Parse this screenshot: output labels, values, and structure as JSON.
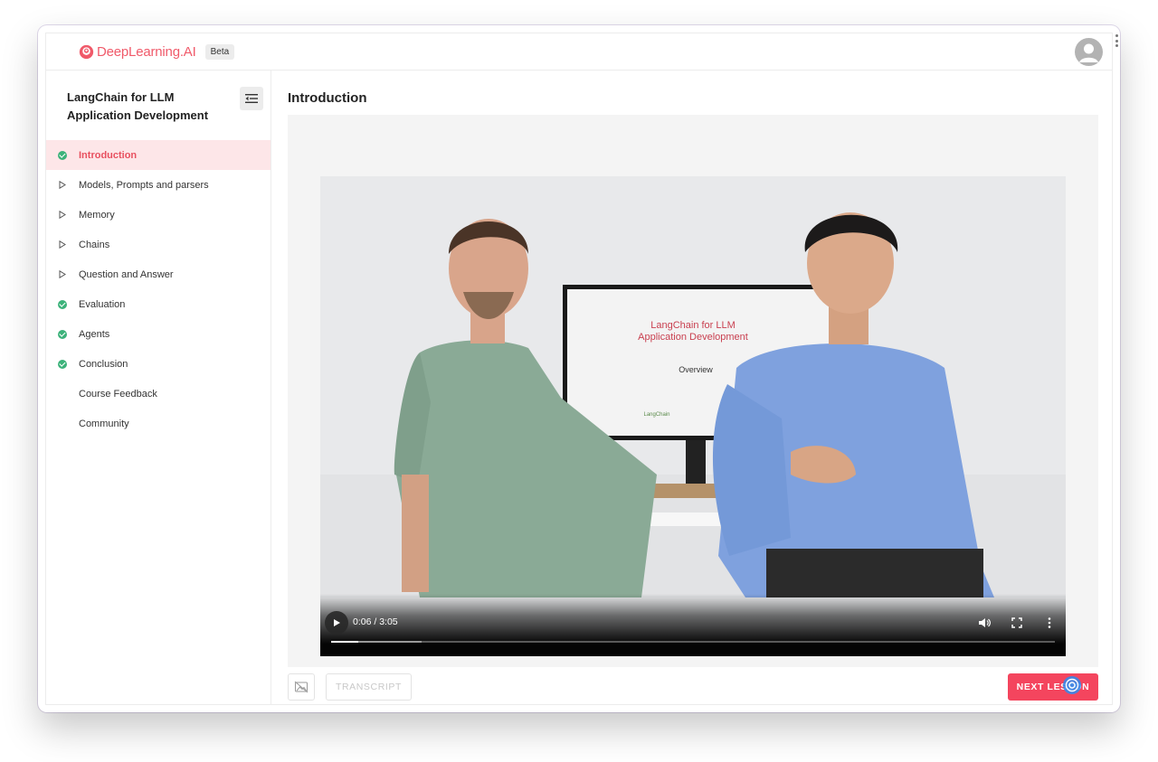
{
  "brand": {
    "name": "DeepLearning.AI",
    "badge": "Beta",
    "color": "#f05a6a",
    "icon": "deeplearning-logo-icon"
  },
  "header": {
    "avatar_icon": "user-avatar-icon"
  },
  "sidebar": {
    "course_title": "LangChain for LLM Application Development",
    "collapse_icon": "collapse-menu-icon",
    "lessons": [
      {
        "label": "Introduction",
        "status": "completed",
        "active": true
      },
      {
        "label": "Models, Prompts and parsers",
        "status": "video",
        "active": false
      },
      {
        "label": "Memory",
        "status": "video",
        "active": false
      },
      {
        "label": "Chains",
        "status": "video",
        "active": false
      },
      {
        "label": "Question and Answer",
        "status": "video",
        "active": false
      },
      {
        "label": "Evaluation",
        "status": "completed",
        "active": false
      },
      {
        "label": "Agents",
        "status": "completed",
        "active": false
      },
      {
        "label": "Conclusion",
        "status": "completed",
        "active": false
      },
      {
        "label": "Course Feedback",
        "status": "none",
        "active": false
      },
      {
        "label": "Community",
        "status": "none",
        "active": false
      }
    ]
  },
  "main": {
    "lesson_title": "Introduction",
    "video": {
      "slide_title_line1": "LangChain for LLM",
      "slide_title_line2": "Application Development",
      "slide_subtitle": "Overview",
      "slide_logo_text": "LangChain",
      "time": "0:06 / 3:05",
      "played_fraction": 0.038,
      "buffered_fraction": 0.125
    },
    "transcript_label": "TRANSCRIPT",
    "next_label": "NEXT LESSON"
  },
  "colors": {
    "accent": "#f4455e",
    "active_bg": "#fde6e8",
    "check": "#3cb27a"
  }
}
